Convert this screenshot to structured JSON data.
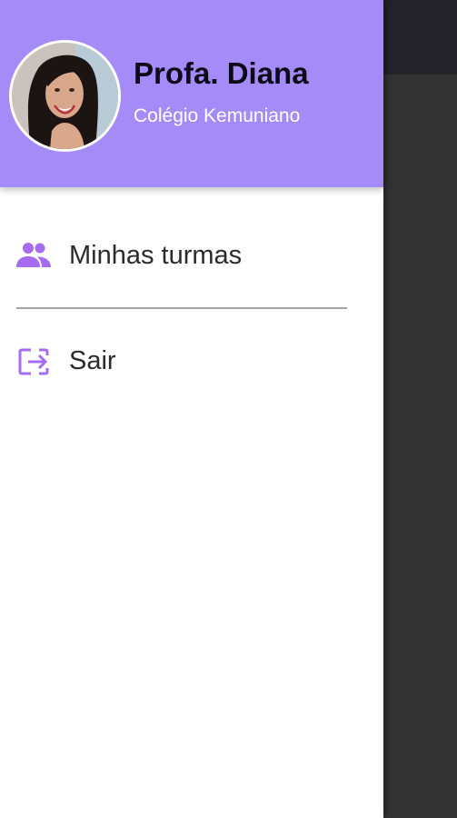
{
  "drawer": {
    "profile": {
      "name": "Profa. Diana",
      "school": "Colégio Kemuniano",
      "avatar_icon": "profile-photo"
    },
    "menu": [
      {
        "label": "Minhas turmas",
        "icon": "people-icon"
      },
      {
        "label": "Sair",
        "icon": "logout-icon"
      }
    ]
  },
  "colors": {
    "header_bg": "#a58bf7",
    "accent": "#a66cf2",
    "scrim": "#333333"
  }
}
